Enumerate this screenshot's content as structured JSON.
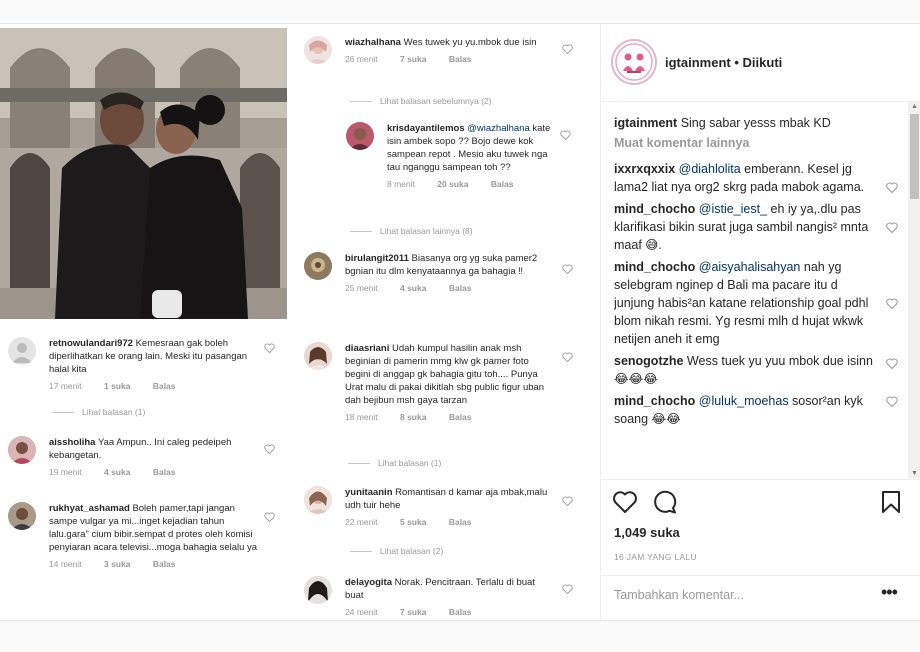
{
  "post": {
    "account": "igtainment",
    "follow_status": "Diikuti",
    "caption_user": "igtainment",
    "caption_text": "Sing sabar yesss mbak KD",
    "load_more": "Muat komentar lainnya",
    "likes": "1,049 suka",
    "time_ago": "16 JAM YANG LALU",
    "add_comment_placeholder": "Tambahkan komentar...",
    "more_options": "•••",
    "comments": [
      {
        "user": "ixxrxqxxix",
        "mention": "@diahlolita",
        "text": " emberann. Kesel jg lama2 liat nya org2 skrg pada mabok agama."
      },
      {
        "user": "mind_chocho",
        "mention": "@istie_iest_",
        "text": " eh iy ya,.dlu pas klarifikasi bikin surat juga sambil nangis² mnta maaf 😅."
      },
      {
        "user": "mind_chocho",
        "mention": "@aisyahalisahyan",
        "text": " nah yg selebgram nginep d Bali ma pacare itu d junjung habis²an katane relationship goal pdhl blom nikah resmi. Yg resmi mlh d hujat wkwk netijen aneh it emg"
      },
      {
        "user": "senogotzhe",
        "mention": "",
        "text": " Wess tuek yu yuu mbok due isinn 😂😂😂"
      },
      {
        "user": "mind_chocho",
        "mention": "@luluk_moehas",
        "text": " sosor²an kyk soang 😂😂"
      }
    ]
  },
  "left_comments": [
    {
      "user": "retnowulandari972",
      "text": "Kemesraan gak boleh diperlihatkan ke orang lain. Meski itu pasangan halal kita",
      "time": "17 menit",
      "likes": "1 suka",
      "reply": "Balas",
      "replies_link": "Lihat balasan (1)"
    },
    {
      "user": "aissholiha",
      "text": "Yaa Ampun.. Ini caleg pedeipeh kebangetan.",
      "time": "19 menit",
      "likes": "4 suka",
      "reply": "Balas"
    },
    {
      "user": "rukhyat_ashamad",
      "text": "Boleh pamer,tapi jangan sampe vulgar ya mi...inget kejadian tahun lalu.gara\" cium bibir.sempat d protes oleh komisi penyiaran acara televisi...moga bahagia selalu ya",
      "time": "14 menit",
      "likes": "3 suka",
      "reply": "Balas"
    }
  ],
  "mid_comments": [
    {
      "user": "wiazhalhana",
      "text": "Wes tuwek yu yu.mbok due isin",
      "time": "26 menit",
      "likes": "7 suka",
      "reply": "Balas",
      "replies_link": "Lihat balasan sebelumnya (2)"
    },
    {
      "user": "krisdayantilemos",
      "mention": "@wiazhalhana",
      "text": " kate isin ambek sopo ?? Bojo dewe kok sampean repot . Mesio aku tuwek nga tau nganggu sampean toh ??",
      "time": "8 menit",
      "likes": "20 suka",
      "reply": "Balas",
      "replies_link": "Lihat balasan lainnya (8)"
    },
    {
      "user": "birulangit2011",
      "text": "Biasanya org yg suka pamer2 bgnian itu dlm kenyataannya ga bahagia ‼",
      "time": "25 menit",
      "likes": "4 suka",
      "reply": "Balas"
    },
    {
      "user": "diaasriani",
      "text": "Udah kumpul hasilin anak msh beginian di pamerin mmg klw gk pamer foto begini di anggap gk bahagia gitu toh.... Punya Urat malu di pakai dikitlah sbg public figur uban dah bejibun msh gaya tarzan",
      "time": "18 menit",
      "likes": "8 suka",
      "reply": "Balas",
      "replies_link": "Lihat balasan (1)"
    },
    {
      "user": "yunitaanin",
      "text": "Romantisan d kamar aja mbak,malu udh tuir hehe",
      "time": "22 menit",
      "likes": "5 suka",
      "reply": "Balas",
      "replies_link": "Lihat balasan (2)"
    },
    {
      "user": "delayogita",
      "text": "Norak. Pencitraan. Terlalu di buat buat",
      "time": "24 menit",
      "likes": "7 suka",
      "reply": "Balas"
    }
  ],
  "colors": {
    "mention": "#003569",
    "muted": "#999999",
    "text": "#262626"
  },
  "icons": [
    "heart-icon",
    "comment-bubble-icon",
    "bookmark-icon",
    "more-dots-icon"
  ]
}
